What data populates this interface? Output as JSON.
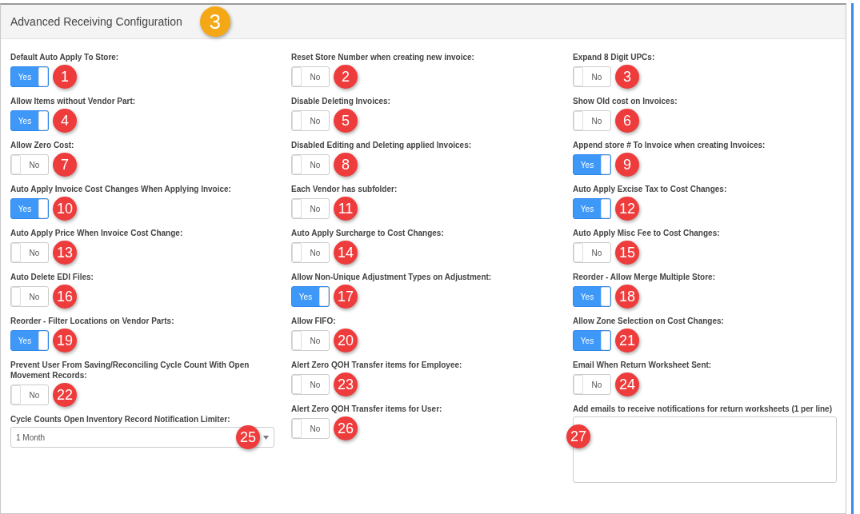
{
  "panel": {
    "title": "Advanced Receiving Configuration",
    "marker": "3"
  },
  "columns": [
    [
      {
        "kind": "toggle",
        "label": "Default Auto Apply To Store:",
        "on": true,
        "text": "Yes",
        "marker": "1"
      },
      {
        "kind": "toggle",
        "label": "Allow Items without Vendor Part:",
        "on": true,
        "text": "Yes",
        "marker": "4"
      },
      {
        "kind": "toggle",
        "label": "Allow Zero Cost:",
        "on": false,
        "text": "No",
        "marker": "7"
      },
      {
        "kind": "toggle",
        "label": "Auto Apply Invoice Cost Changes When Applying Invoice:",
        "on": true,
        "text": "Yes",
        "marker": "10"
      },
      {
        "kind": "toggle",
        "label": "Auto Apply Price When Invoice Cost Change:",
        "on": false,
        "text": "No",
        "marker": "13"
      },
      {
        "kind": "toggle",
        "label": "Auto Delete EDI Files:",
        "on": false,
        "text": "No",
        "marker": "16"
      },
      {
        "kind": "toggle",
        "label": "Reorder - Filter Locations on Vendor Parts:",
        "on": true,
        "text": "Yes",
        "marker": "19"
      },
      {
        "kind": "toggle",
        "label": "Prevent User From Saving/Reconciling Cycle Count With Open Movement Records:",
        "on": false,
        "text": "No",
        "marker": "22"
      },
      {
        "kind": "select",
        "label": "Cycle Counts Open Inventory Record Notification Limiter:",
        "value": "1 Month",
        "marker": "25"
      }
    ],
    [
      {
        "kind": "toggle",
        "label": "Reset Store Number when creating new invoice:",
        "on": false,
        "text": "No",
        "marker": "2"
      },
      {
        "kind": "toggle",
        "label": "Disable Deleting Invoices:",
        "on": false,
        "text": "No",
        "marker": "5"
      },
      {
        "kind": "toggle",
        "label": "Disabled Editing and Deleting applied Invoices:",
        "on": false,
        "text": "No",
        "marker": "8"
      },
      {
        "kind": "toggle",
        "label": "Each Vendor has subfolder:",
        "on": false,
        "text": "No",
        "marker": "11"
      },
      {
        "kind": "toggle",
        "label": "Auto Apply Surcharge to Cost Changes:",
        "on": false,
        "text": "No",
        "marker": "14"
      },
      {
        "kind": "toggle",
        "label": "Allow Non-Unique Adjustment Types on Adjustment:",
        "on": true,
        "text": "Yes",
        "marker": "17"
      },
      {
        "kind": "toggle",
        "label": "Allow FIFO:",
        "on": false,
        "text": "No",
        "marker": "20"
      },
      {
        "kind": "toggle",
        "label": "Alert Zero QOH Transfer items for Employee:",
        "on": false,
        "text": "No",
        "marker": "23"
      },
      {
        "kind": "toggle",
        "label": "Alert Zero QOH Transfer items for User:",
        "on": false,
        "text": "No",
        "marker": "26"
      }
    ],
    [
      {
        "kind": "toggle",
        "label": "Expand 8 Digit UPCs:",
        "on": false,
        "text": "No",
        "marker": "3"
      },
      {
        "kind": "toggle",
        "label": "Show Old cost on Invoices:",
        "on": false,
        "text": "No",
        "marker": "6"
      },
      {
        "kind": "toggle",
        "label": "Append store # To Invoice when creating Invoices:",
        "on": true,
        "text": "Yes",
        "marker": "9"
      },
      {
        "kind": "toggle",
        "label": "Auto Apply Excise Tax to Cost Changes:",
        "on": true,
        "text": "Yes",
        "marker": "12"
      },
      {
        "kind": "toggle",
        "label": "Auto Apply Misc Fee to Cost Changes:",
        "on": false,
        "text": "No",
        "marker": "15"
      },
      {
        "kind": "toggle",
        "label": "Reorder - Allow Merge Multiple Store:",
        "on": true,
        "text": "Yes",
        "marker": "18"
      },
      {
        "kind": "toggle",
        "label": "Allow Zone Selection on Cost Changes:",
        "on": true,
        "text": "Yes",
        "marker": "21"
      },
      {
        "kind": "toggle",
        "label": "Email When Return Worksheet Sent:",
        "on": false,
        "text": "No",
        "marker": "24"
      },
      {
        "kind": "textarea",
        "label": "Add emails to receive notifications for return worksheets (1 per line)",
        "marker": "27"
      }
    ]
  ]
}
